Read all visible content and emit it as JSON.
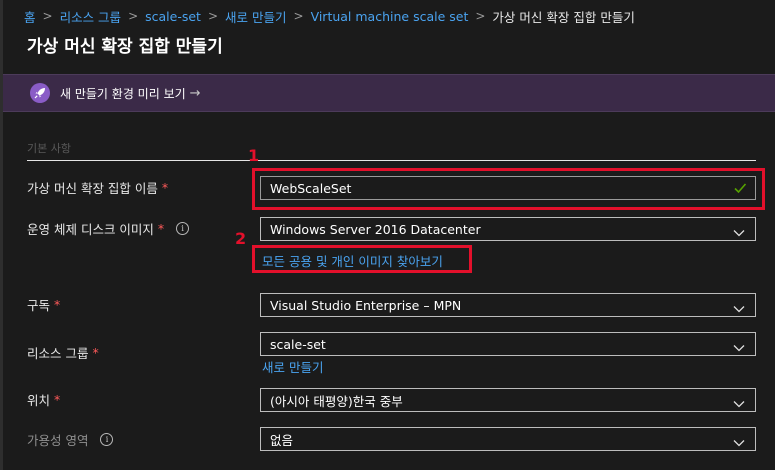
{
  "breadcrumb": {
    "items": [
      "홈",
      "리소스 그룹",
      "scale-set",
      "새로 만들기",
      "Virtual machine scale set"
    ],
    "current": "가상 머신 확장 집합 만들기",
    "separator": ">"
  },
  "page": {
    "title": "가상 머신 확장 집합 만들기"
  },
  "banner": {
    "text": "새 만들기 환경 미리 보기",
    "arrow": "→",
    "icon": "rocket-icon"
  },
  "section": {
    "label": "기본 사항"
  },
  "form": {
    "name": {
      "label": "가상 머신 확장 집합 이름",
      "required": "*",
      "value": "WebScaleSet",
      "status_icon": "checkmark-icon"
    },
    "os_image": {
      "label": "운영 체제 디스크 이미지",
      "required": "*",
      "info": "i",
      "value": "Windows Server 2016 Datacenter",
      "browse_link": "모든 공용 및 개인 이미지 찾아보기"
    },
    "subscription": {
      "label": "구독",
      "required": "*",
      "value": "Visual Studio Enterprise – MPN"
    },
    "resource_group": {
      "label": "리소스 그룹",
      "required": "*",
      "value": "scale-set",
      "create_new_link": "새로 만들기"
    },
    "location": {
      "label": "위치",
      "required": "*",
      "value": "(아시아 태평양)한국 중부"
    },
    "availability_zone": {
      "label": "가용성 영역",
      "info": "i",
      "value": "없음"
    }
  },
  "annotations": {
    "marker_1": "1",
    "marker_2": "2"
  },
  "colors": {
    "background": "#1b1b1b",
    "link": "#4aa3f0",
    "required": "#ff5a5a",
    "highlight": "#e3102b",
    "banner": "#3b2a48",
    "check": "#57a300"
  }
}
